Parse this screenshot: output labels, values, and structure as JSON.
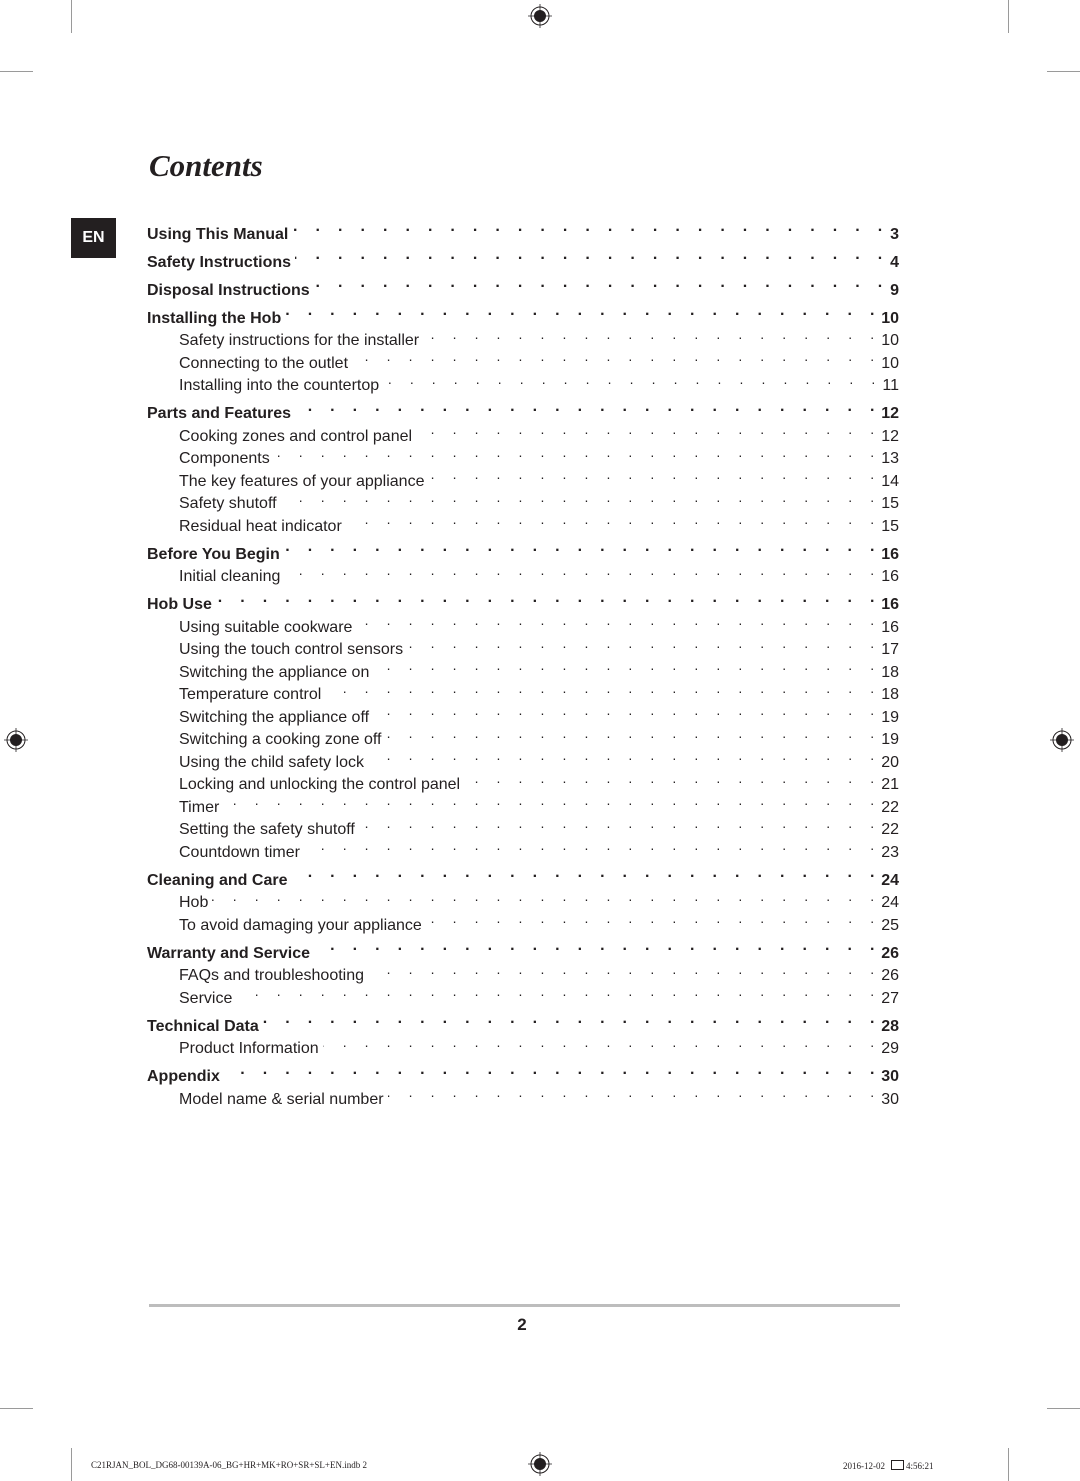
{
  "page": {
    "title": "Contents",
    "language_tab": "EN",
    "page_number": "2"
  },
  "toc": [
    {
      "level": 1,
      "label": "Using This Manual",
      "page": "3"
    },
    {
      "level": 1,
      "label": "Safety Instructions",
      "page": "4"
    },
    {
      "level": 1,
      "label": "Disposal Instructions",
      "page": "9"
    },
    {
      "level": 1,
      "label": "Installing the Hob",
      "page": "10"
    },
    {
      "level": 2,
      "label": "Safety instructions for the installer",
      "page": "10"
    },
    {
      "level": 2,
      "label": "Connecting to the outlet",
      "page": "10"
    },
    {
      "level": 2,
      "label": "Installing into the countertop",
      "page": "11"
    },
    {
      "level": 1,
      "label": "Parts and Features",
      "page": "12"
    },
    {
      "level": 2,
      "label": "Cooking zones and control panel",
      "page": "12"
    },
    {
      "level": 2,
      "label": "Components",
      "page": "13"
    },
    {
      "level": 2,
      "label": "The key features of your appliance",
      "page": "14"
    },
    {
      "level": 2,
      "label": "Safety shutoff",
      "page": "15"
    },
    {
      "level": 2,
      "label": "Residual heat indicator",
      "page": "15"
    },
    {
      "level": 1,
      "label": "Before You Begin",
      "page": "16"
    },
    {
      "level": 2,
      "label": "Initial cleaning",
      "page": "16"
    },
    {
      "level": 1,
      "label": "Hob Use",
      "page": "16"
    },
    {
      "level": 2,
      "label": "Using suitable cookware",
      "page": "16"
    },
    {
      "level": 2,
      "label": "Using the touch control sensors",
      "page": "17"
    },
    {
      "level": 2,
      "label": "Switching the appliance on",
      "page": "18"
    },
    {
      "level": 2,
      "label": "Temperature control",
      "page": "18"
    },
    {
      "level": 2,
      "label": "Switching the appliance off",
      "page": "19"
    },
    {
      "level": 2,
      "label": "Switching a cooking zone off",
      "page": "19"
    },
    {
      "level": 2,
      "label": "Using the child safety lock",
      "page": "20"
    },
    {
      "level": 2,
      "label": "Locking and unlocking the control panel",
      "page": "21"
    },
    {
      "level": 2,
      "label": "Timer",
      "page": "22"
    },
    {
      "level": 2,
      "label": "Setting the safety shutoff",
      "page": "22"
    },
    {
      "level": 2,
      "label": "Countdown timer",
      "page": "23"
    },
    {
      "level": 1,
      "label": "Cleaning and Care",
      "page": "24"
    },
    {
      "level": 2,
      "label": "Hob",
      "page": "24"
    },
    {
      "level": 2,
      "label": "To avoid damaging your appliance",
      "page": "25"
    },
    {
      "level": 1,
      "label": "Warranty and Service",
      "page": "26"
    },
    {
      "level": 2,
      "label": "FAQs and troubleshooting",
      "page": "26"
    },
    {
      "level": 2,
      "label": "Service",
      "page": "27"
    },
    {
      "level": 1,
      "label": "Technical Data",
      "page": "28"
    },
    {
      "level": 2,
      "label": "Product Information",
      "page": "29"
    },
    {
      "level": 1,
      "label": "Appendix",
      "page": "30"
    },
    {
      "level": 2,
      "label": "Model name & serial number",
      "page": "30"
    }
  ],
  "slug": {
    "file": "C21RJAN_BOL_DG68-00139A-06_BG+HR+MK+RO+SR+SL+EN.indb   2",
    "date": "2016-12-02",
    "time": "4:56:21"
  },
  "icons": {
    "registration_mark": "registration-mark-icon"
  }
}
